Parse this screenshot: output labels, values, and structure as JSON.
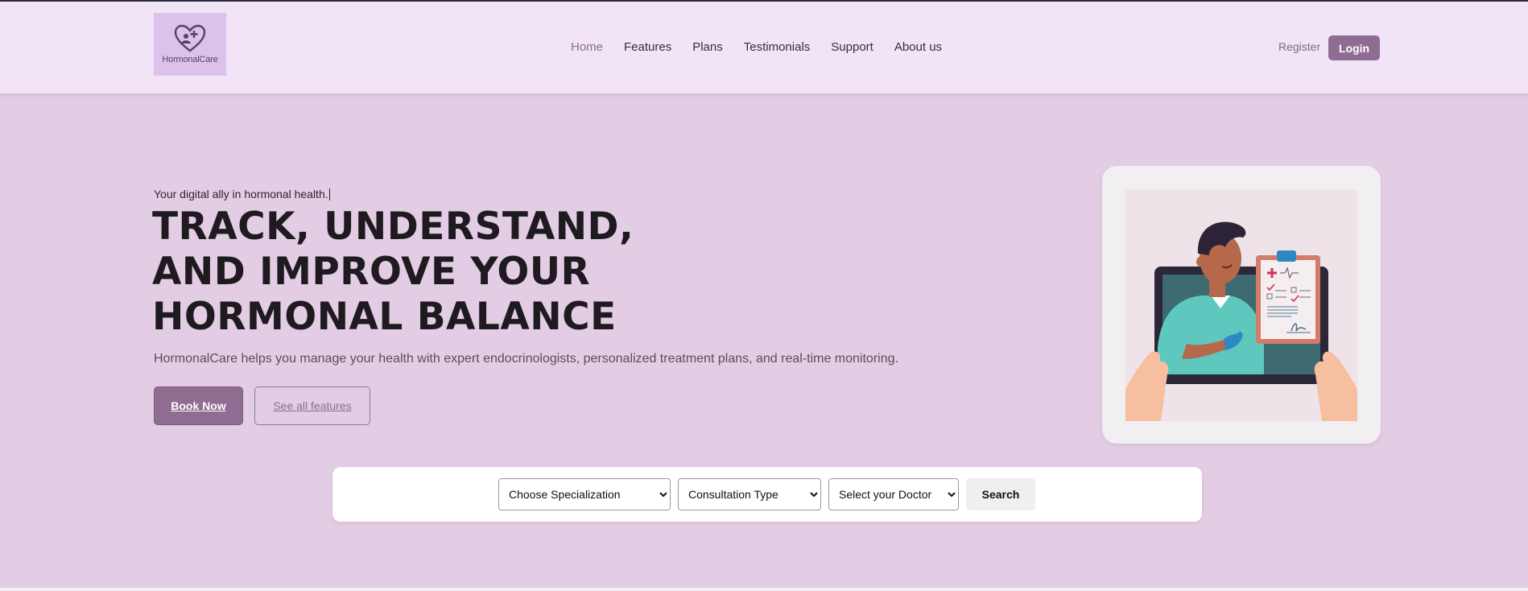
{
  "header": {
    "logo_text": "HormonalCare",
    "nav": [
      {
        "label": "Home",
        "active": true
      },
      {
        "label": "Features"
      },
      {
        "label": "Plans"
      },
      {
        "label": "Testimonials"
      },
      {
        "label": "Support"
      },
      {
        "label": "About us"
      }
    ],
    "register_label": "Register",
    "login_label": "Login"
  },
  "hero": {
    "tagline": "Your digital ally in hormonal health.",
    "headline_lines": [
      "TRACK, UNDERSTAND,",
      "AND IMPROVE YOUR",
      "HORMONAL BALANCE"
    ],
    "description": "HormonalCare helps you manage your health with expert endocrinologists, personalized treatment plans, and real-time monitoring.",
    "book_label": "Book Now",
    "features_label": "See all features"
  },
  "search": {
    "specialization": "Choose Specialization",
    "consultation_type": "Consultation Type",
    "doctor": "Select your Doctor",
    "button_label": "Search"
  },
  "colors": {
    "accent": "#8f6c91",
    "header_bg": "#f2e4f7",
    "hero_bg": "#e3cde5"
  },
  "icons": {
    "logo": "heart-people-plus-icon",
    "illustration": "doctor-telemedicine-illustration"
  }
}
